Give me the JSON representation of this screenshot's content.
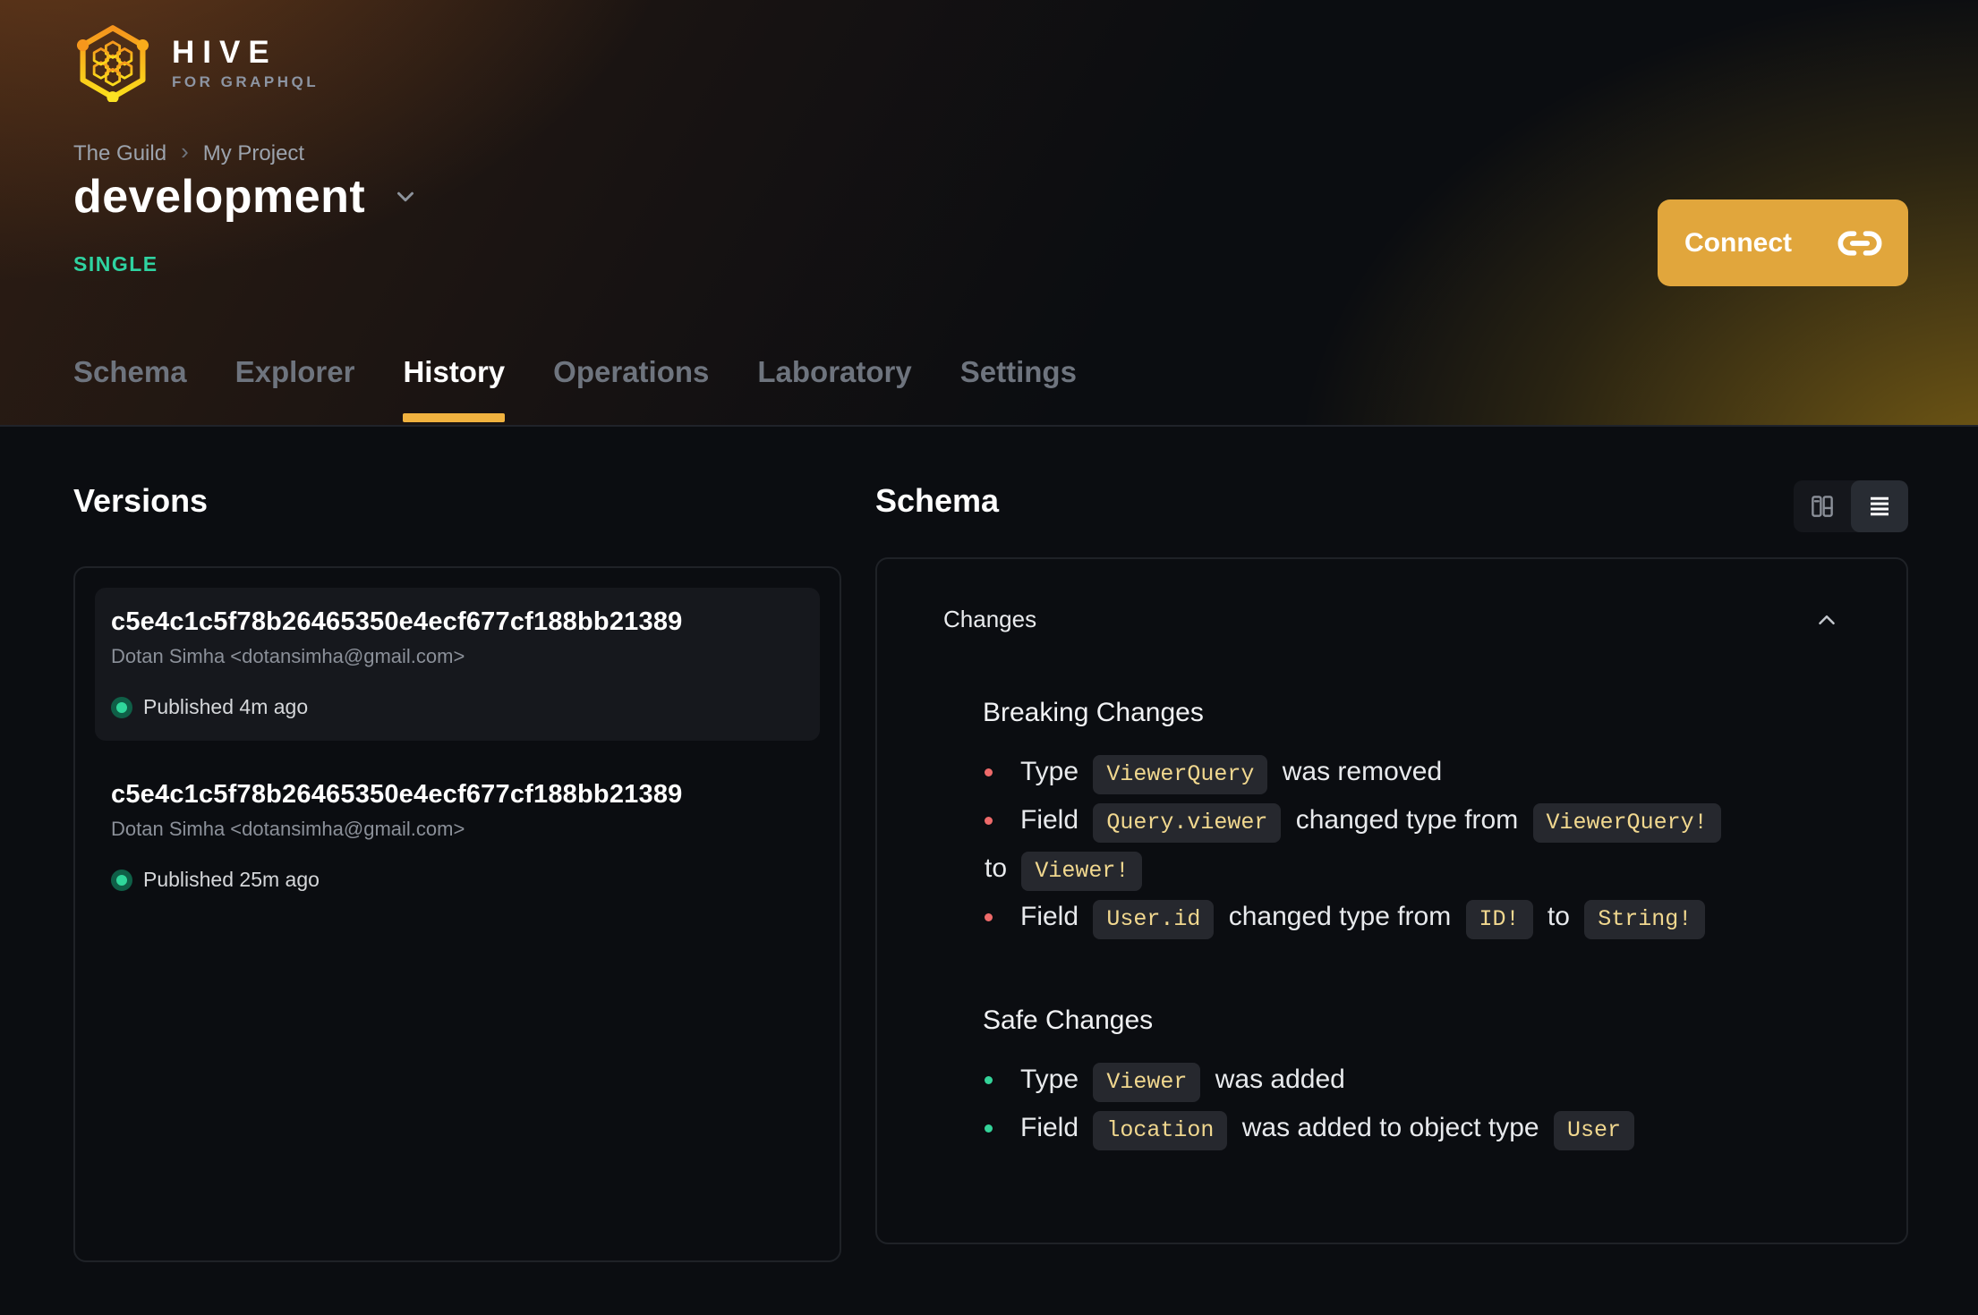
{
  "brand": {
    "name": "HIVE",
    "tagline": "FOR GRAPHQL"
  },
  "breadcrumb": {
    "org": "The Guild",
    "project": "My Project"
  },
  "header": {
    "title": "development",
    "badge": "SINGLE",
    "connect_label": "Connect"
  },
  "tabs": [
    {
      "label": "Schema",
      "active": false
    },
    {
      "label": "Explorer",
      "active": false
    },
    {
      "label": "History",
      "active": true
    },
    {
      "label": "Operations",
      "active": false
    },
    {
      "label": "Laboratory",
      "active": false
    },
    {
      "label": "Settings",
      "active": false
    }
  ],
  "versions": {
    "heading": "Versions",
    "items": [
      {
        "hash": "c5e4c1c5f78b26465350e4ecf677cf188bb21389",
        "author": "Dotan Simha <dotansimha@gmail.com>",
        "status": "Published 4m ago",
        "selected": true
      },
      {
        "hash": "c5e4c1c5f78b26465350e4ecf677cf188bb21389",
        "author": "Dotan Simha <dotansimha@gmail.com>",
        "status": "Published 25m ago",
        "selected": false
      }
    ]
  },
  "schema_panel": {
    "heading": "Schema",
    "changes_label": "Changes",
    "groups": [
      {
        "title": "Breaking Changes",
        "severity": "breaking",
        "items": [
          [
            {
              "text": "Type "
            },
            {
              "code": "ViewerQuery"
            },
            {
              "text": " was removed"
            }
          ],
          [
            {
              "text": "Field "
            },
            {
              "code": "Query.viewer"
            },
            {
              "text": " changed type from "
            },
            {
              "code": "ViewerQuery!"
            },
            {
              "text": " to "
            },
            {
              "code": "Viewer!"
            }
          ],
          [
            {
              "text": "Field "
            },
            {
              "code": "User.id"
            },
            {
              "text": " changed type from "
            },
            {
              "code": "ID!"
            },
            {
              "text": " to "
            },
            {
              "code": "String!"
            }
          ]
        ]
      },
      {
        "title": "Safe Changes",
        "severity": "safe",
        "items": [
          [
            {
              "text": "Type "
            },
            {
              "code": "Viewer"
            },
            {
              "text": " was added"
            }
          ],
          [
            {
              "text": "Field "
            },
            {
              "code": "location"
            },
            {
              "text": " was added to object type "
            },
            {
              "code": "User"
            }
          ]
        ]
      }
    ]
  },
  "icons": {
    "logo": "hive-logo-icon",
    "title_caret": "chevron-down-icon",
    "connect": "link-icon",
    "view_left": "columns-view-icon",
    "view_right": "list-view-icon",
    "collapse": "chevron-up-icon",
    "status": "published-dot"
  },
  "colors": {
    "accent": "#f0b23f",
    "connect": "#e1a63c",
    "single": "#2fd3a1",
    "breaking": "#ee6a6a",
    "safe": "#34d399",
    "badge-text": "#f1d88f",
    "badge-bg": "#26282e",
    "dot": "#2fd79b"
  }
}
